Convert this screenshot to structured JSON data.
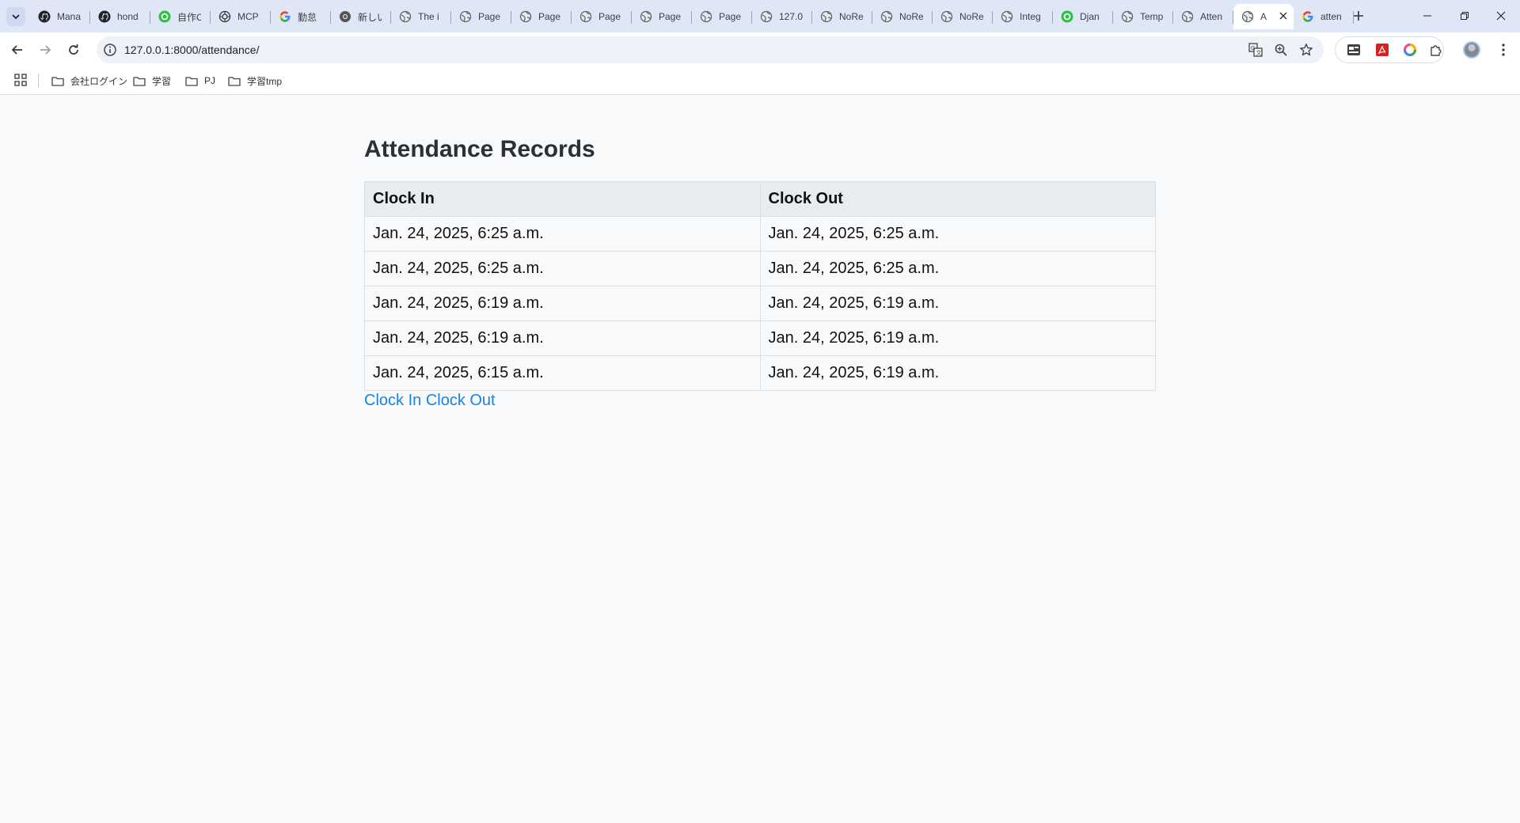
{
  "browser": {
    "tabs": [
      {
        "label": "Mana",
        "icon": "github-icon"
      },
      {
        "label": "hond",
        "icon": "github-icon"
      },
      {
        "label": "自作C",
        "icon": "green-site-icon"
      },
      {
        "label": "MCP",
        "icon": "openai-icon"
      },
      {
        "label": "勤怠",
        "icon": "google-icon"
      },
      {
        "label": "新しい",
        "icon": "chrome-icon"
      },
      {
        "label": "The i",
        "icon": "globe-icon"
      },
      {
        "label": "Page",
        "icon": "globe-icon"
      },
      {
        "label": "Page",
        "icon": "globe-icon"
      },
      {
        "label": "Page",
        "icon": "globe-icon"
      },
      {
        "label": "Page",
        "icon": "globe-icon"
      },
      {
        "label": "Page",
        "icon": "globe-icon"
      },
      {
        "label": "127.0",
        "icon": "globe-icon"
      },
      {
        "label": "NoRe",
        "icon": "globe-icon"
      },
      {
        "label": "NoRe",
        "icon": "globe-icon"
      },
      {
        "label": "NoRe",
        "icon": "globe-icon"
      },
      {
        "label": "Integ",
        "icon": "globe-icon"
      },
      {
        "label": "Djan",
        "icon": "green-site-icon"
      },
      {
        "label": "Temp",
        "icon": "globe-icon"
      },
      {
        "label": "Atten",
        "icon": "globe-icon"
      },
      {
        "label": "A",
        "icon": "globe-icon",
        "active": true
      },
      {
        "label": "atten",
        "icon": "google-icon"
      }
    ],
    "url": "127.0.0.1:8000/attendance/",
    "bookmarks": [
      {
        "label": "会社ログイン"
      },
      {
        "label": "学習"
      },
      {
        "label": "PJ"
      },
      {
        "label": "学習tmp"
      }
    ]
  },
  "page": {
    "title": "Attendance Records",
    "table": {
      "headers": [
        "Clock In",
        "Clock Out"
      ],
      "rows": [
        [
          "Jan. 24, 2025, 6:25 a.m.",
          "Jan. 24, 2025, 6:25 a.m."
        ],
        [
          "Jan. 24, 2025, 6:25 a.m.",
          "Jan. 24, 2025, 6:25 a.m."
        ],
        [
          "Jan. 24, 2025, 6:19 a.m.",
          "Jan. 24, 2025, 6:19 a.m."
        ],
        [
          "Jan. 24, 2025, 6:19 a.m.",
          "Jan. 24, 2025, 6:19 a.m."
        ],
        [
          "Jan. 24, 2025, 6:15 a.m.",
          "Jan. 24, 2025, 6:19 a.m."
        ]
      ]
    },
    "links": {
      "clock_in": "Clock In",
      "clock_out": "Clock Out"
    }
  },
  "colors": {
    "link": "#1a82e2",
    "tabstrip": "#dfe7f6",
    "page_background": "#f8f9fa"
  }
}
